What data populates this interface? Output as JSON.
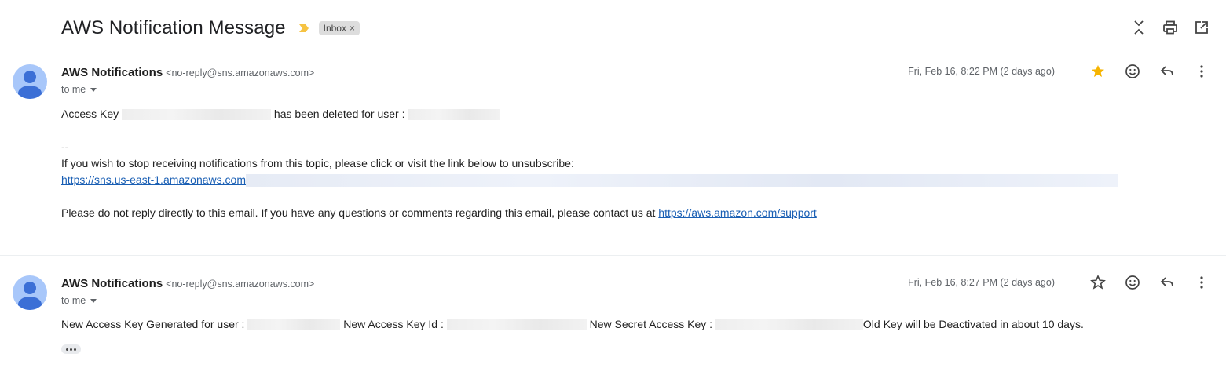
{
  "thread": {
    "subject": "AWS Notification Message",
    "label": "Inbox",
    "label_remove": "×"
  },
  "colors": {
    "star_filled": "#f6b400",
    "label_bg": "#dddddd",
    "link": "#1a5fb4",
    "avatar_bg": "#a8c7fa",
    "avatar_fg": "#3b6fd6"
  },
  "messages": [
    {
      "sender_name": "AWS Notifications",
      "sender_email": "<no-reply@sns.amazonaws.com>",
      "to": "to me",
      "date": "Fri, Feb 16, 8:22 PM (2 days ago)",
      "starred": true,
      "body": {
        "line1_a": "Access Key",
        "line1_b": "has been deleted for user :",
        "sig": "--",
        "unsub_text": "If you wish to stop receiving notifications from this topic, please click or visit the link below to unsubscribe:",
        "unsub_link": "https://sns.us-east-1.amazonaws.com",
        "footer_text": "Please do not reply directly to this email. If you have any questions or comments regarding this email, please contact us at",
        "support_link": "https://aws.amazon.com/support"
      }
    },
    {
      "sender_name": "AWS Notifications",
      "sender_email": "<no-reply@sns.amazonaws.com>",
      "to": "to me",
      "date": "Fri, Feb 16, 8:27 PM (2 days ago)",
      "starred": false,
      "body": {
        "part_a": "New Access Key Generated for user :",
        "part_b": "New Access Key Id :",
        "part_c": "New Secret Access Key :",
        "part_d": "Old Key will be Deactivated in about 10 days."
      }
    }
  ],
  "icons": {
    "importance": "importance-marker-icon",
    "collapse": "expand-collapse-icon",
    "print": "print-icon",
    "open_new": "open-in-new-window-icon",
    "star": "star-icon",
    "emoji": "emoji-reaction-icon",
    "reply": "reply-icon",
    "more": "more-vert-icon",
    "ellipsis": "show-trimmed-content-icon"
  }
}
